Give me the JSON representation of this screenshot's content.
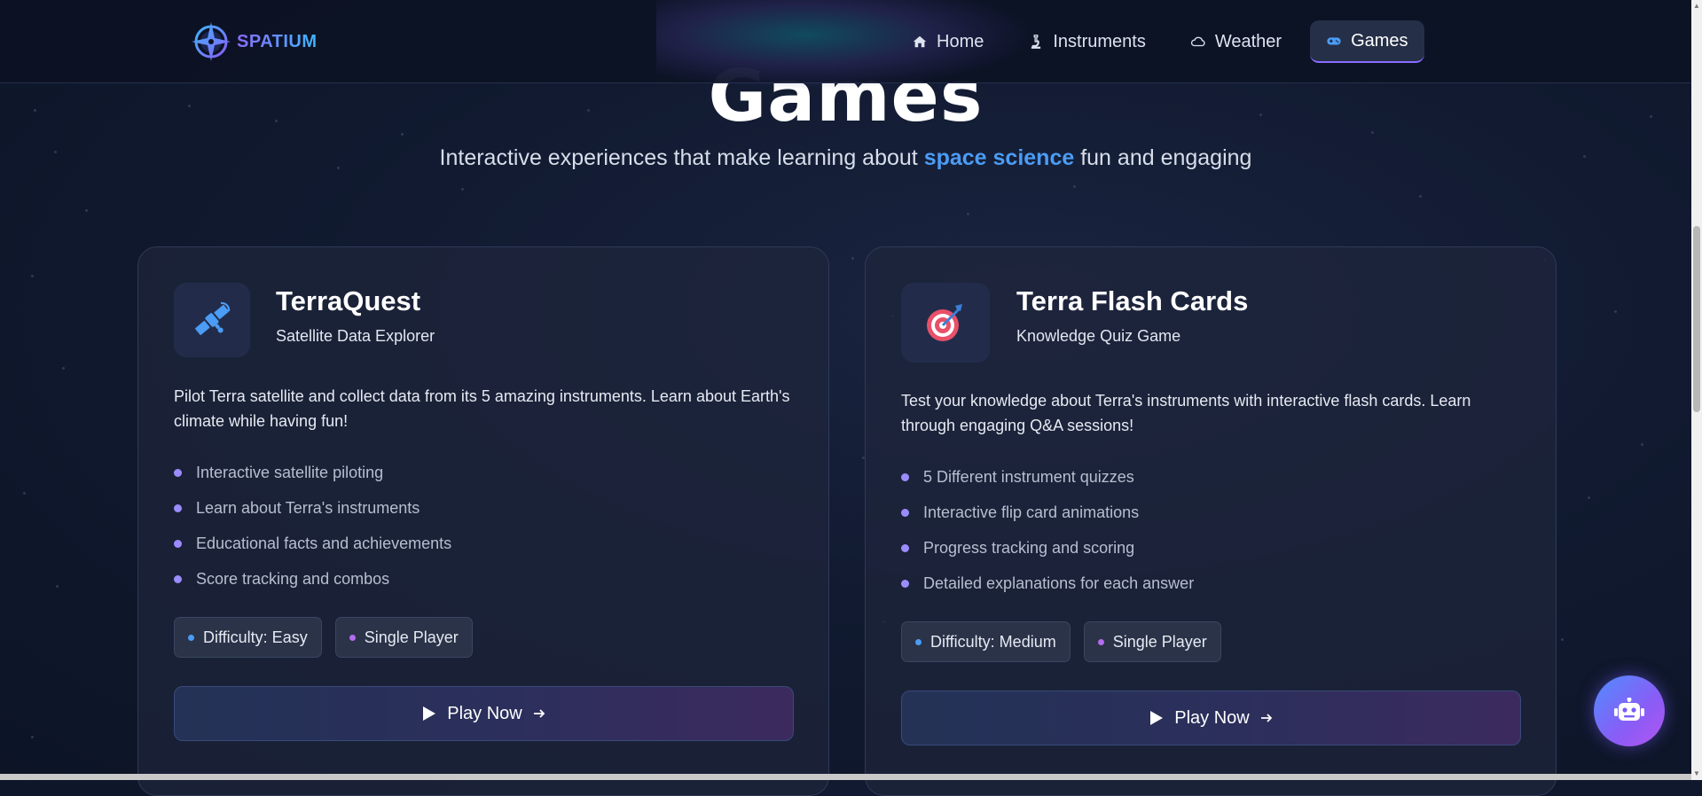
{
  "brand": {
    "name": "SPATIUM",
    "icon": "compass-icon"
  },
  "nav": {
    "items": [
      {
        "label": "Home",
        "icon": "home-icon",
        "active": false
      },
      {
        "label": "Instruments",
        "icon": "microscope-icon",
        "active": false
      },
      {
        "label": "Weather",
        "icon": "cloud-icon",
        "active": false
      },
      {
        "label": "Games",
        "icon": "gamepad-icon",
        "active": true
      }
    ]
  },
  "hero": {
    "title": "Games",
    "subtitle_before": "Interactive experiences that make learning about ",
    "subtitle_highlight": "space science",
    "subtitle_after": " fun and engaging"
  },
  "cards": [
    {
      "title": "TerraQuest",
      "subtitle": "Satellite Data Explorer",
      "icon": "satellite-icon",
      "description": "Pilot Terra satellite and collect data from its 5 amazing instruments. Learn about Earth's climate while having fun!",
      "features": [
        "Interactive satellite piloting",
        "Learn about Terra's instruments",
        "Educational facts and achievements",
        "Score tracking and combos"
      ],
      "difficulty": "Difficulty: Easy",
      "players": "Single Player",
      "cta": "Play Now"
    },
    {
      "title": "Terra Flash Cards",
      "subtitle": "Knowledge Quiz Game",
      "icon": "target-icon",
      "description": "Test your knowledge about Terra's instruments with interactive flash cards. Learn through engaging Q&A sessions!",
      "features": [
        "5 Different instrument quizzes",
        "Interactive flip card animations",
        "Progress tracking and scoring",
        "Detailed explanations for each answer"
      ],
      "difficulty": "Difficulty: Medium",
      "players": "Single Player",
      "cta": "Play Now"
    }
  ],
  "assistant": {
    "icon": "robot-icon"
  },
  "colors": {
    "accent_blue": "#4b9cf5",
    "accent_purple": "#8b6cff",
    "background": "#111a30",
    "card": "#1e263c"
  }
}
